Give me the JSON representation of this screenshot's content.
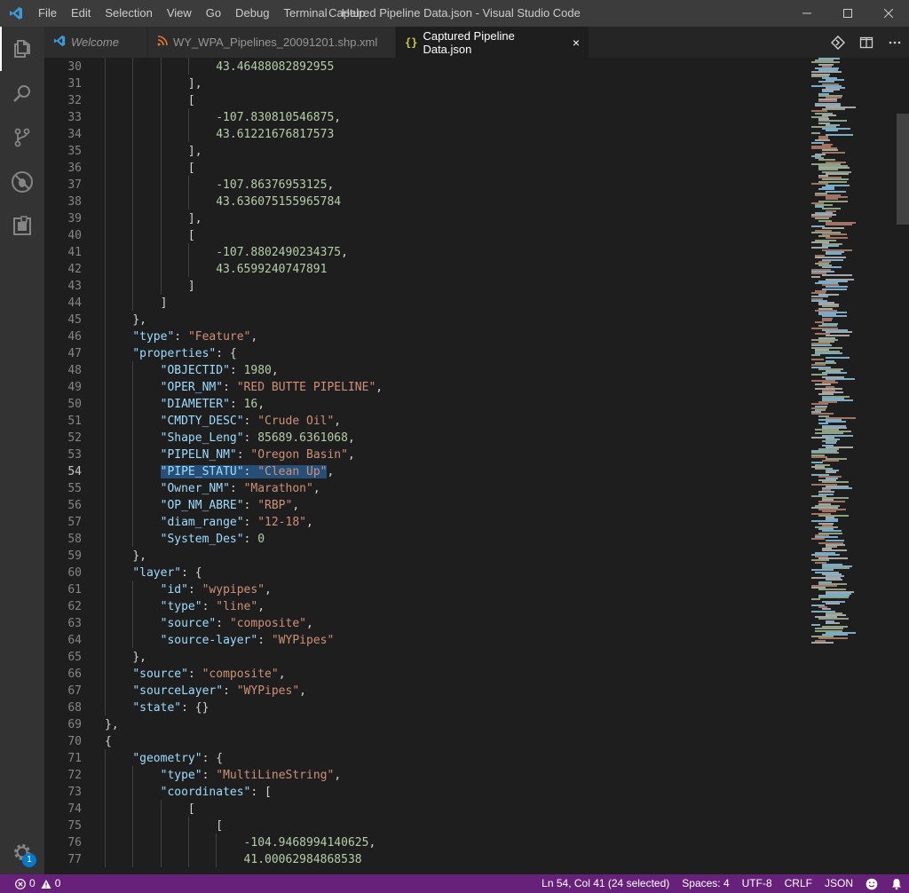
{
  "window": {
    "title": "Captured Pipeline Data.json - Visual Studio Code",
    "menu": [
      "File",
      "Edit",
      "Selection",
      "View",
      "Go",
      "Debug",
      "Terminal",
      "Help"
    ]
  },
  "activity_bar": {
    "items": [
      "explorer-icon",
      "search-icon",
      "source-control-icon",
      "debug-icon",
      "extensions-icon"
    ],
    "settings_badge": "1"
  },
  "tabs": [
    {
      "label": "Welcome",
      "icon": "vscode-logo-icon",
      "italic": true,
      "active": false
    },
    {
      "label": "WY_WPA_Pipelines_20091201.shp.xml",
      "icon": "rss-icon",
      "italic": false,
      "active": false
    },
    {
      "label": "Captured Pipeline Data.json",
      "icon": "{}",
      "italic": false,
      "active": true
    }
  ],
  "editor": {
    "current_line": 54,
    "lines": [
      {
        "n": 30,
        "code": "                43.4648808289295 5"
      },
      {
        "n": 31,
        "code": "            ],"
      },
      {
        "n": 32,
        "code": "            ["
      },
      {
        "n": 33,
        "code": "                -107.830810546875,"
      },
      {
        "n": 34,
        "code": "                43.61221676817573"
      },
      {
        "n": 35,
        "code": "            ],"
      },
      {
        "n": 36,
        "code": "            ["
      },
      {
        "n": 37,
        "code": "                -107.86376953125,"
      },
      {
        "n": 38,
        "code": "                43.636075155965784"
      },
      {
        "n": 39,
        "code": "            ],"
      },
      {
        "n": 40,
        "code": "            ["
      },
      {
        "n": 41,
        "code": "                -107.8802490234375,"
      },
      {
        "n": 42,
        "code": "                43.6599240747891"
      },
      {
        "n": 43,
        "code": "            ]"
      },
      {
        "n": 44,
        "code": "        ]"
      },
      {
        "n": 45,
        "code": "    },"
      },
      {
        "n": 46,
        "code": "    \"type\": \"Feature\","
      },
      {
        "n": 47,
        "code": "    \"properties\": {"
      },
      {
        "n": 48,
        "code": "        \"OBJECTID\": 1980,"
      },
      {
        "n": 49,
        "code": "        \"OPER_NM\": \"RED BUTTE PIPELINE\","
      },
      {
        "n": 50,
        "code": "        \"DIAMETER\": 16,"
      },
      {
        "n": 51,
        "code": "        \"CMDTY_DESC\": \"Crude Oil\","
      },
      {
        "n": 52,
        "code": "        \"Shape_Leng\": 85689.6361068,"
      },
      {
        "n": 53,
        "code": "        \"PIPELN_NM\": \"Oregon Basin\","
      },
      {
        "n": 54,
        "code": "        \"PIPE_STATU\": \"Clean Up\","
      },
      {
        "n": 55,
        "code": "        \"Owner_NM\": \"Marathon\","
      },
      {
        "n": 56,
        "code": "        \"OP_NM_ABRE\": \"RBP\","
      },
      {
        "n": 57,
        "code": "        \"diam_range\": \"12-18\","
      },
      {
        "n": 58,
        "code": "        \"System_Des\": 0"
      },
      {
        "n": 59,
        "code": "    },"
      },
      {
        "n": 60,
        "code": "    \"layer\": {"
      },
      {
        "n": 61,
        "code": "        \"id\": \"wypipes\","
      },
      {
        "n": 62,
        "code": "        \"type\": \"line\","
      },
      {
        "n": 63,
        "code": "        \"source\": \"composite\","
      },
      {
        "n": 64,
        "code": "        \"source-layer\": \"WYPipes\""
      },
      {
        "n": 65,
        "code": "    },"
      },
      {
        "n": 66,
        "code": "    \"source\": \"composite\","
      },
      {
        "n": 67,
        "code": "    \"sourceLayer\": \"WYPipes\","
      },
      {
        "n": 68,
        "code": "    \"state\": {}"
      },
      {
        "n": 69,
        "code": "},"
      },
      {
        "n": 70,
        "code": "{"
      },
      {
        "n": 71,
        "code": "    \"geometry\": {"
      },
      {
        "n": 72,
        "code": "        \"type\": \"MultiLineString\","
      },
      {
        "n": 73,
        "code": "        \"coordinates\": ["
      },
      {
        "n": 74,
        "code": "            ["
      },
      {
        "n": 75,
        "code": "                ["
      },
      {
        "n": 76,
        "code": "                    -104.9468994140625,"
      },
      {
        "n": 77,
        "code": "                    41.00062984868538"
      }
    ]
  },
  "status_bar": {
    "errors": "0",
    "warnings": "0",
    "position": "Ln 54, Col 41 (24 selected)",
    "spaces": "Spaces: 4",
    "encoding": "UTF-8",
    "eol": "CRLF",
    "language": "JSON"
  },
  "colors": {
    "statusbar": "#68217a",
    "key": "#9cdcfe",
    "string": "#ce9178",
    "number": "#b5cea8",
    "selection": "#264f78"
  }
}
